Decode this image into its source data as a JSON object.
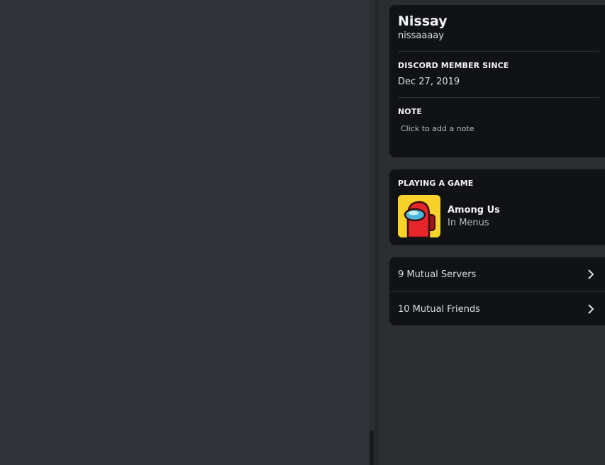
{
  "profile": {
    "display_name": "Nissay",
    "username": "nissaaaay",
    "member_since_heading": "DISCORD MEMBER SINCE",
    "member_since_value": "Dec 27, 2019",
    "note_heading": "NOTE",
    "note_placeholder": "Click to add a note"
  },
  "activity": {
    "heading": "PLAYING A GAME",
    "game_name": "Among Us",
    "game_state": "In Menus",
    "icon": "among-us-crewmate-icon"
  },
  "mutuals": {
    "servers_label": "9 Mutual Servers",
    "friends_label": "10 Mutual Friends",
    "chevron_icon": "chevron-right-icon"
  },
  "colors": {
    "background": "#313338",
    "panel": "#2b2d31",
    "card": "#111214",
    "text_primary": "#f2f3f5",
    "text_secondary": "#b5bac1",
    "game_icon_bg": "#f8d22b",
    "crewmate_red": "#e5262b"
  }
}
